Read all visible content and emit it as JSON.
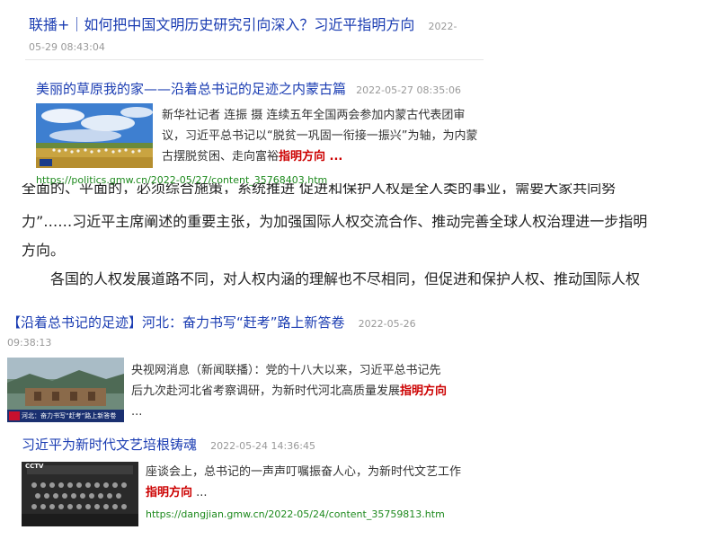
{
  "result1": {
    "title": "联播+｜如何把中国文明历史研究引向深入？习近平指明方向",
    "date_part1": "2022-",
    "date_part2": "05-29 08:43:04"
  },
  "result2": {
    "title": "美丽的草原我的家——沿着总书记的足迹之内蒙古篇",
    "date": "2022-05-27 08:35:06",
    "snippet_line1": "新华社记者 连振 摄 连续五年全国两会参加内蒙古代表团审",
    "snippet_line2": "议，习近平总书记以“脱贫一巩固一衔接一振兴”为轴，为内蒙",
    "snippet_line3_pre": "古摆脱贫困、走向富裕",
    "snippet_highlight": "指明方向",
    "snippet_line3_post": " ...",
    "url": "https://politics.gmw.cn/2022-05/27/content_35768403.htm"
  },
  "article": {
    "cut_line": "全面的、平面的，必须综合施策，系统推进 促进和保护人权是全人类的事业，需要大家共同努",
    "line1": "力”……习近平主席阐述的重要主张，为加强国际人权交流合作、推动完善全球人权治理进一步指明",
    "line2": "方向。",
    "line3": "各国的人权发展道路不同，对人权内涵的理解也不尽相同，但促进和保护人权、推动国际人权"
  },
  "result3": {
    "title": "【沿着总书记的足迹】河北：奋力书写“赶考”路上新答卷",
    "date_part1": "2022-05-26",
    "date_part2": "09:38:13",
    "snippet_line1": "央视网消息（新闻联播）：党的十八大以来，习近平总书记先",
    "snippet_line2_pre": "后九次赴河北省考察调研，为新时代河北高质量发展",
    "snippet_highlight": "指明方向",
    "snippet_line3": "...",
    "thumb_caption": "河北：奋力书写“赶考”路上新答卷"
  },
  "result4": {
    "title": "习近平为新时代文艺培根铸魂",
    "date": "2022-05-24 14:36:45",
    "snippet_line1": "座谈会上，总书记的一声声叮嘱振奋人心，为新时代文艺工作",
    "snippet_highlight": "指明方向",
    "snippet_line2_post": " ...",
    "url": "https://dangjian.gmw.cn/2022-05/24/content_35759813.htm",
    "thumb_logo": "CCTV"
  },
  "colors": {
    "title_blue": "#1a3cb2",
    "highlight_red": "#cc0000",
    "url_green": "#1e8a1e",
    "date_gray": "#999999"
  }
}
